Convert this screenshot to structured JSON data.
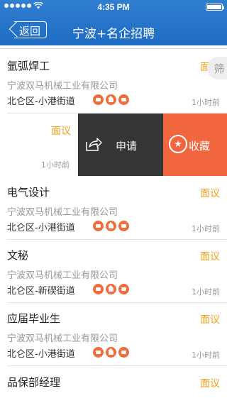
{
  "status_bar": {
    "time": "4:35 PM"
  },
  "nav": {
    "back_label": "返回",
    "title": "宁波+名企招聘"
  },
  "filter": {
    "label": "筛"
  },
  "jobs": [
    {
      "title": "氩弧焊工",
      "salary": "面议",
      "company": "宁波双马机械工业有限公司",
      "location": "北仑区-小港街道",
      "time_ago": "1小时前"
    },
    {
      "title": "",
      "salary": "面议",
      "company": "",
      "location": "",
      "time_ago": "1小时前"
    },
    {
      "title": "电气设计",
      "salary": "面议",
      "company": "宁波双马机械工业有限公司",
      "location": "北仑区-小港街道",
      "time_ago": "1小时前"
    },
    {
      "title": "文秘",
      "salary": "面议",
      "company": "宁波双马机械工业有限公司",
      "location": "北仑区-新碶街道",
      "time_ago": "1小时前"
    },
    {
      "title": "应届毕业生",
      "salary": "面议",
      "company": "宁波双马机械工业有限公司",
      "location": "北仑区-小港街道",
      "time_ago": "1小时前"
    },
    {
      "title": "品保部经理",
      "salary": "面议",
      "company": "",
      "location": "",
      "time_ago": ""
    }
  ],
  "swipe_actions": {
    "apply_label": "申请",
    "favorite_label": "收藏"
  },
  "badge_icons": [
    "meal-icon",
    "housing-icon",
    "shuttle-bus-icon"
  ],
  "colors": {
    "nav_blue": "#2276cc",
    "salary_orange": "#f0a01e",
    "apply_bg": "#333536",
    "favorite_bg": "#f2663f",
    "badge_orange": "#f26b3a"
  }
}
